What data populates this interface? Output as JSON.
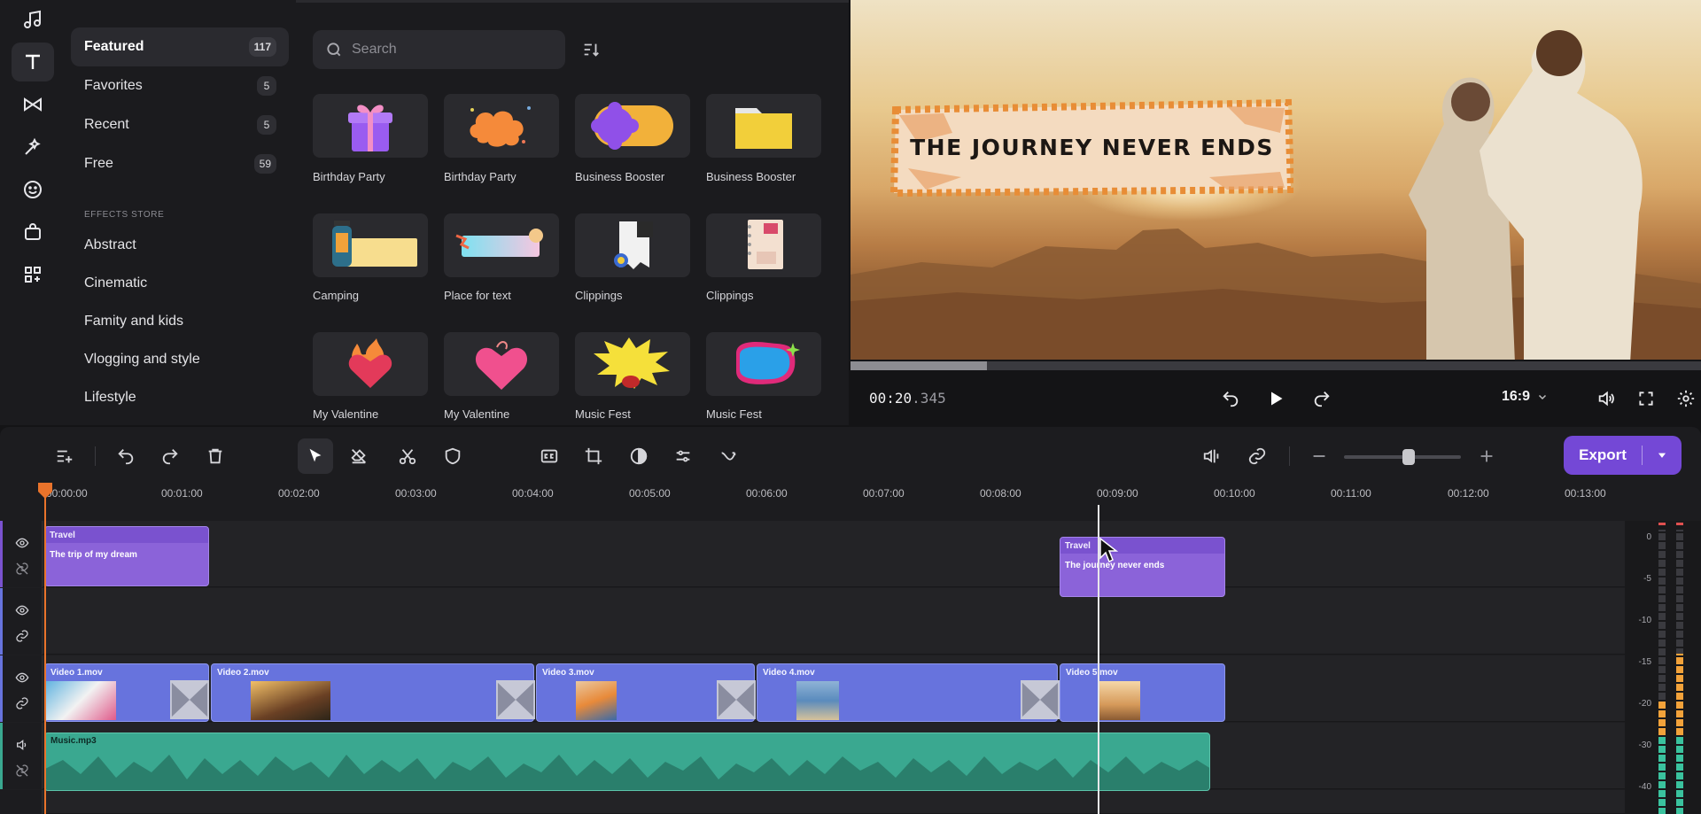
{
  "rail": {
    "icons": [
      "music-icon",
      "text-icon",
      "transitions-icon",
      "effects-icon",
      "stickers-icon",
      "store-icon",
      "apps-icon"
    ]
  },
  "categories": [
    {
      "label": "Featured",
      "count": "117"
    },
    {
      "label": "Favorites",
      "count": "5"
    },
    {
      "label": "Recent",
      "count": "5"
    },
    {
      "label": "Free",
      "count": "59"
    }
  ],
  "store": {
    "heading": "EFFECTS STORE",
    "items": [
      "Abstract",
      "Cinematic",
      "Famity and kids",
      "Vlogging and style",
      "Lifestyle"
    ]
  },
  "search": {
    "placeholder": "Search"
  },
  "tiles": [
    {
      "label": "Birthday Party",
      "icon": "gift-icon"
    },
    {
      "label": "Birthday Party",
      "icon": "cloud-icon"
    },
    {
      "label": "Business Booster",
      "icon": "flower-pill-icon"
    },
    {
      "label": "Business Booster",
      "icon": "folder-icon"
    },
    {
      "label": "Camping",
      "icon": "lantern-icon"
    },
    {
      "label": "Place for text",
      "icon": "ribbon-icon"
    },
    {
      "label": "Clippings",
      "icon": "clipping-icon"
    },
    {
      "label": "Clippings",
      "icon": "notebook-icon"
    },
    {
      "label": "My Valentine",
      "icon": "flaming-heart-icon"
    },
    {
      "label": "My Valentine",
      "icon": "heart-icon"
    },
    {
      "label": "Music Fest",
      "icon": "burst-icon"
    },
    {
      "label": "Music Fest",
      "icon": "blue-blob-icon"
    }
  ],
  "preview": {
    "title_text": "THE JOURNEY NEVER ENDS",
    "timecode_main": "00:20",
    "timecode_ms": ".345",
    "aspect_ratio": "16:9",
    "progress": 0.16
  },
  "toolbar": {
    "export_label": "Export",
    "zoom_level": 0.55
  },
  "ruler": [
    "00:00:00",
    "00:01:00",
    "00:02:00",
    "00:03:00",
    "00:04:00",
    "00:05:00",
    "00:06:00",
    "00:07:00",
    "00:08:00",
    "00:09:00",
    "00:10:00",
    "00:11:00",
    "00:12:00",
    "00:13:00"
  ],
  "timeline": {
    "title_clips": [
      {
        "head": "Travel",
        "text": "The trip of my dream"
      },
      {
        "head": "Travel",
        "text": "The journey never ends"
      }
    ],
    "video_clips": [
      "Video 1.mov",
      "Video 2.mov",
      "Video 3.mov",
      "Video 4.mov",
      "Video 5.mov"
    ],
    "audio_clip": "Music.mp3"
  },
  "meter_labels": [
    "0",
    "-5",
    "-10",
    "-15",
    "-20",
    "-30",
    "-40"
  ],
  "colors": {
    "accent": "#7448d6",
    "playhead": "#e9732b",
    "video_clip": "#6773dd",
    "title_clip": "#8b63d9",
    "audio_clip": "#3aa890"
  }
}
